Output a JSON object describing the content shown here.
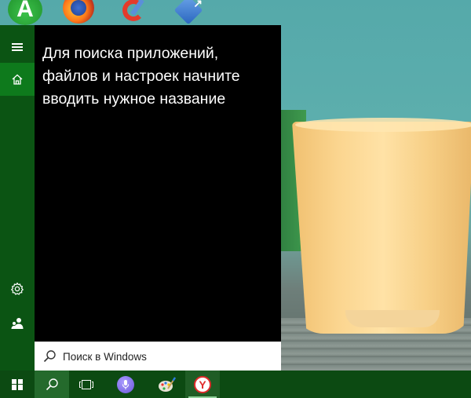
{
  "desktop": {
    "icons": [
      {
        "name": "green-app-icon",
        "glyph": "A"
      },
      {
        "name": "firefox-icon"
      },
      {
        "name": "ccleaner-icon"
      },
      {
        "name": "tool-app-icon",
        "glyph": "↗"
      }
    ]
  },
  "start_menu": {
    "rail": {
      "menu_icon": "hamburger-icon",
      "home_icon": "home-icon",
      "settings_icon": "gear-icon",
      "user_icon": "user-icon"
    },
    "search_hint": "Для поиска приложений, файлов и настроек начните вводить нужное название"
  },
  "search": {
    "placeholder": "Поиск в Windows",
    "value": ""
  },
  "taskbar": {
    "items": [
      "start",
      "search",
      "task-view",
      "cortana",
      "paint",
      "yandex-browser"
    ],
    "yandex_glyph": "Y",
    "accent_color": "#0c4a12",
    "active_color": "#246a2c"
  }
}
